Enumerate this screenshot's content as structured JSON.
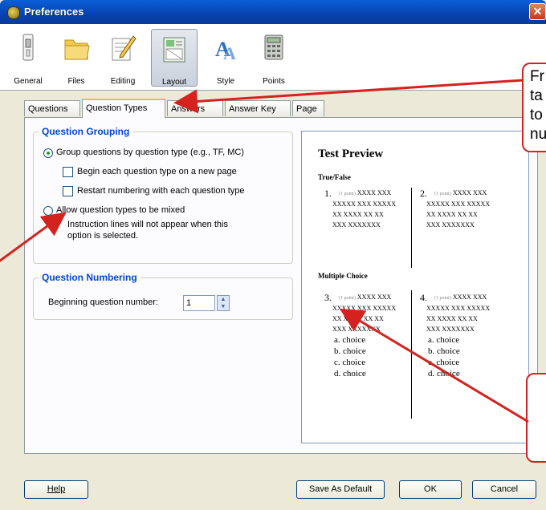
{
  "window": {
    "title": "Preferences",
    "close_glyph": "✕"
  },
  "toolbar": {
    "items": [
      {
        "label": "General",
        "icon": "switch-icon"
      },
      {
        "label": "Files",
        "icon": "folder-icon"
      },
      {
        "label": "Editing",
        "icon": "pencil-paper-icon"
      },
      {
        "label": "Layout",
        "icon": "layout-icon",
        "active": true
      },
      {
        "label": "Style",
        "icon": "font-style-icon"
      },
      {
        "label": "Points",
        "icon": "calculator-icon"
      }
    ]
  },
  "tabs": [
    "Questions",
    "Question Types",
    "Answers",
    "Answer Key",
    "Page"
  ],
  "grouping": {
    "legend": "Question Grouping",
    "group_by_type": "Group questions by question type (e.g., TF, MC)",
    "new_page": "Begin each question type on a new page",
    "restart_numbering": "Restart numbering with each question type",
    "allow_mixed": "Allow question types to be mixed",
    "note_line1": "Instruction lines will not appear when this",
    "note_line2": "option is selected."
  },
  "numbering": {
    "legend": "Question Numbering",
    "label": "Beginning question number:",
    "value": "1"
  },
  "preview": {
    "title": "Test Preview",
    "section_tf": "True/False",
    "section_mc": "Multiple Choice",
    "points_label": "(1 point)",
    "q1": "1.",
    "q2": "2.",
    "q3": "3.",
    "q4": "4.",
    "line_a": "XXXX XXX",
    "line_b": "XXXXX XXX XXXXX",
    "line_c": "XX XXXX XX XX",
    "line_d": "XXX XXXXXXX",
    "choices": [
      "a.  choice",
      "b.  choice",
      "c.  choice",
      "d.  choice"
    ]
  },
  "buttons": {
    "help": "Help",
    "save_default": "Save As Default",
    "ok": "OK",
    "cancel": "Cancel"
  },
  "callouts": {
    "top_line1": "Fr",
    "top_line2": "ta",
    "top_line3": "to",
    "top_line4": "nu"
  },
  "colors": {
    "callout_border": "#d4221f",
    "legend": "#0046d5",
    "title_bar": "#0842b0"
  }
}
